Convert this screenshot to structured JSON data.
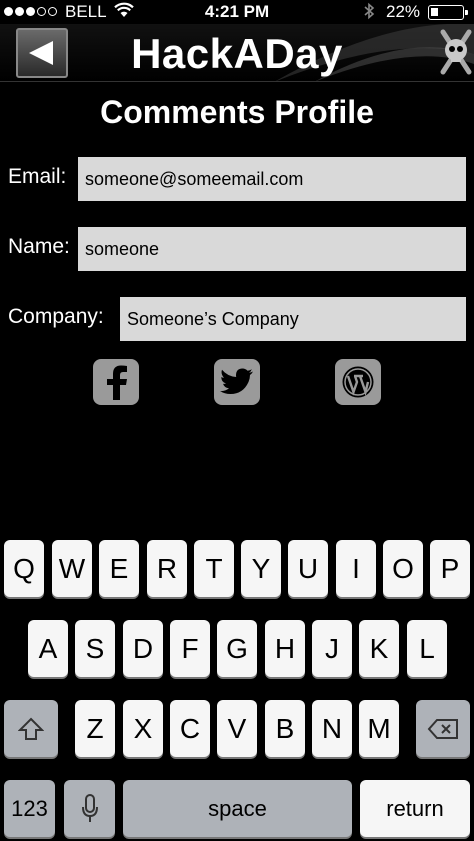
{
  "status_bar": {
    "carrier": "BELL",
    "time": "4:21 PM",
    "battery": "22%",
    "signal_bars": 3,
    "battery_level": 0.22
  },
  "nav": {
    "title": "HackADay",
    "back_icon": "back-arrow-icon",
    "logo_icon": "skull-wrenches-icon"
  },
  "page": {
    "title": "Comments Profile"
  },
  "form": {
    "email_label": "Email:",
    "email_value": "someone@someemail.com",
    "name_label": "Name:",
    "name_value": "someone",
    "company_label": "Company:",
    "company_value": "Someone’s Company"
  },
  "social": [
    {
      "icon": "facebook-icon"
    },
    {
      "icon": "twitter-icon"
    },
    {
      "icon": "wordpress-icon"
    }
  ],
  "keyboard": {
    "row1": [
      "Q",
      "W",
      "E",
      "R",
      "T",
      "Y",
      "U",
      "I",
      "O",
      "P"
    ],
    "row2": [
      "A",
      "S",
      "D",
      "F",
      "G",
      "H",
      "J",
      "K",
      "L"
    ],
    "row3": [
      "Z",
      "X",
      "C",
      "V",
      "B",
      "N",
      "M"
    ],
    "numbers_key": "123",
    "space_key": "space",
    "return_key": "return"
  }
}
